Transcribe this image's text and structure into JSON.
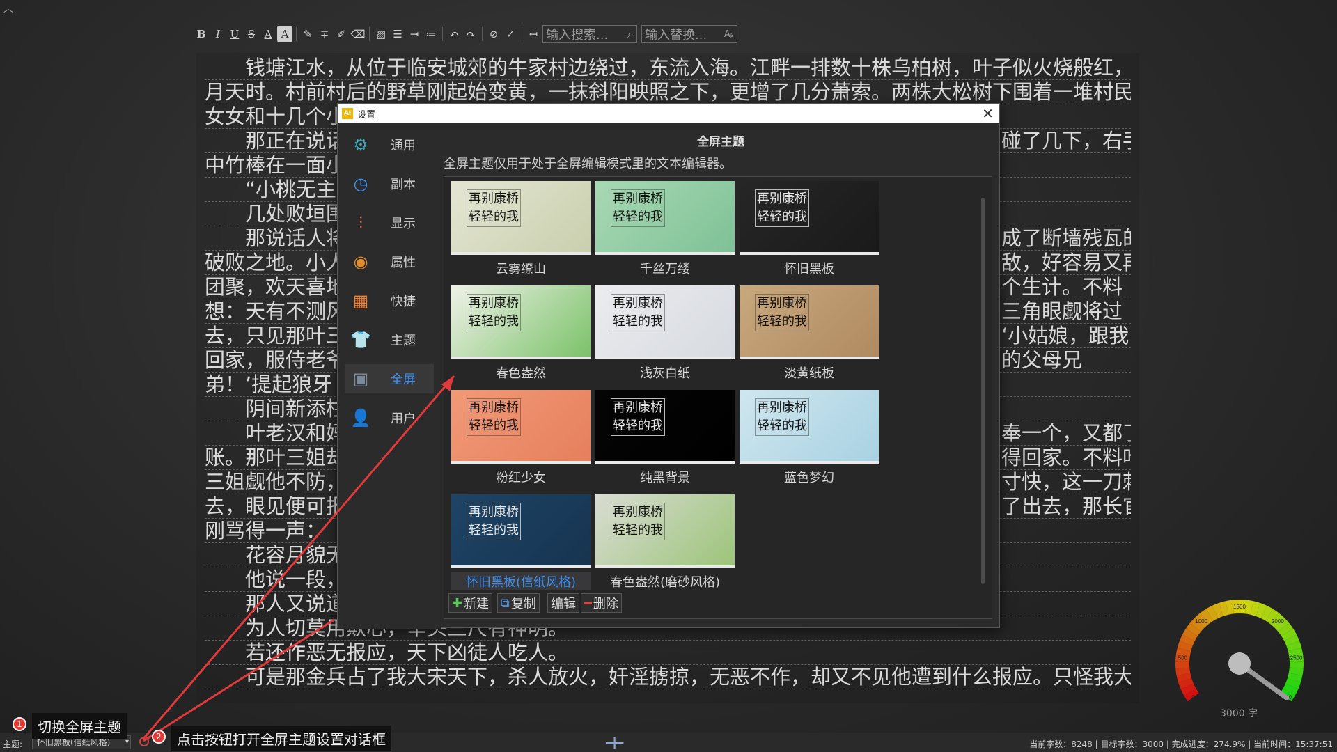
{
  "toolbar": {
    "icons": [
      "bold-icon",
      "italic-icon",
      "underline-icon",
      "strikethrough-icon",
      "font-color-icon",
      "highlight-icon",
      "pen-icon",
      "clear-format-icon",
      "pencil-icon",
      "eraser-icon",
      "image-icon",
      "align-icon",
      "indent-icon",
      "list-icon",
      "undo-icon",
      "redo-icon",
      "hide-icon",
      "spellcheck-icon",
      "return-icon"
    ],
    "search_placeholder": "输入搜索...",
    "replace_placeholder": "输入替换..."
  },
  "editor": {
    "lines": [
      {
        "text": "钱塘江水，从位于临安城郊的牛家村边绕过，东流入海。江畔一排数十株乌柏树，叶子似火烧般红，正是八",
        "indent": true
      },
      {
        "text": "月天时。村前村后的野草刚起始变黄，一抹斜阳映照之下，更增了几分萧索。两株大松树下围着一堆村民，男男",
        "indent": false
      },
      {
        "text": "女女和十几个小",
        "indent": false
      },
      {
        "text": "那正在说话",
        "indent": true,
        "right": "碰了几下，右手"
      },
      {
        "text": "中竹棒在一面小",
        "indent": false
      },
      {
        "text": "“小桃无主",
        "indent": true
      },
      {
        "text": "几处败垣围",
        "indent": true
      },
      {
        "text": "那说话人将",
        "indent": true,
        "right": "成了断墙残瓦的"
      },
      {
        "text": "破败之地。小人",
        "indent": false,
        "right": "敌，好容易又再"
      },
      {
        "text": "团聚，欢天喜地",
        "indent": false,
        "right": "个生计。不料"
      },
      {
        "text": "想：天有不测风",
        "indent": false,
        "right": "三角眼觑将过"
      },
      {
        "text": "去，只见那叶三",
        "indent": false,
        "right": "‘小姑娘，跟我"
      },
      {
        "text": "回家，服侍老爷",
        "indent": false,
        "right": "的父母兄"
      },
      {
        "text": "弟！’提起狼牙",
        "indent": false
      },
      {
        "text": "阴间新添柱",
        "indent": true
      },
      {
        "text": "叶老汉和妈",
        "indent": true,
        "right": "奉一个，又都了"
      },
      {
        "text": "账。那叶三姐却",
        "indent": false,
        "right": "得回家。不料叶"
      },
      {
        "text": "三姐觑他不防，",
        "indent": false,
        "right": "寸快，这一刀刺"
      },
      {
        "text": "去，眼见便可报",
        "indent": false,
        "right": "了出去，那长官"
      },
      {
        "text": "刚骂得一声：",
        "indent": false
      },
      {
        "text": "花容月貌无",
        "indent": true
      },
      {
        "text": "他说一段，",
        "indent": true
      },
      {
        "text": "那人又说道",
        "indent": true
      },
      {
        "text": "为人切莫用欺心，举头三尺有神明。",
        "indent": true
      },
      {
        "text": "若还作恶无报应，天下凶徒人吃人。",
        "indent": true
      },
      {
        "text": "可是那金兵占了我大宋天下，杀人放火，奸淫掳掠，无恶不作，却又不见他遭到什么报应。只怪我大宋官家",
        "indent": true
      }
    ]
  },
  "dialog": {
    "title": "设置",
    "app_icon_text": "AI",
    "close_label": "✕",
    "nav": [
      {
        "label": "通用",
        "icon": "gear-icon",
        "glyph": "⚙",
        "color": "#3fa7b5"
      },
      {
        "label": "副本",
        "icon": "clock-icon",
        "glyph": "◷",
        "color": "#3d8ef0"
      },
      {
        "label": "显示",
        "icon": "sliders-icon",
        "glyph": "⫶",
        "color": "#e05555"
      },
      {
        "label": "属性",
        "icon": "color-wheel-icon",
        "glyph": "◉",
        "color": "#e08a2a"
      },
      {
        "label": "快捷",
        "icon": "keyboard-icon",
        "glyph": "▦",
        "color": "#f08030"
      },
      {
        "label": "主题",
        "icon": "shirt-icon",
        "glyph": "👕",
        "color": "#2aa6d8"
      },
      {
        "label": "全屏",
        "icon": "fullscreen-icon",
        "glyph": "▣",
        "color": "#7a8a9a"
      },
      {
        "label": "用户",
        "icon": "user-settings-icon",
        "glyph": "👤",
        "color": "#3d8ef0"
      }
    ],
    "selected_nav": 6,
    "panel_title": "全屏主题",
    "panel_desc": "全屏主题仅用于处于全屏编辑模式里的文本编辑器。",
    "sample_line1": "再别康桥",
    "sample_line2": "轻轻的我",
    "themes": [
      {
        "name": "云雾缭山",
        "bg": "#e4e6d2",
        "bg2": "#c9cfae"
      },
      {
        "name": "千丝万缕",
        "bg": "#a8d9b4",
        "bg2": "#7fc196"
      },
      {
        "name": "怀旧黑板",
        "bg": "#262626",
        "bg2": "#1a1a1a"
      },
      {
        "name": "春色盎然",
        "bg": "#eef1e6",
        "bg2": "#7bc26a"
      },
      {
        "name": "浅灰白纸",
        "bg": "#eaecef",
        "bg2": "#d7dadf"
      },
      {
        "name": "淡黄纸板",
        "bg": "#c9a87e",
        "bg2": "#b08a60"
      },
      {
        "name": "粉红少女",
        "bg": "#f19a78",
        "bg2": "#e67f5c"
      },
      {
        "name": "纯黑背景",
        "bg": "#050505",
        "bg2": "#000000"
      },
      {
        "name": "蓝色梦幻",
        "bg": "#cfe6ef",
        "bg2": "#a9d2e2"
      },
      {
        "name": "怀旧黑板(信纸风格)",
        "bg": "#1e4466",
        "bg2": "#163450"
      },
      {
        "name": "春色盎然(磨砂风格)",
        "bg": "#d9dcd2",
        "bg2": "#9cc47a"
      }
    ],
    "selected_theme": 9,
    "actions": [
      {
        "label": "新建",
        "icon": "plus-icon",
        "glyph": "✚",
        "color": "#5cc85c"
      },
      {
        "label": "复制",
        "icon": "copy-icon",
        "glyph": "⧉",
        "color": "#4a8fe0"
      },
      {
        "label": "编辑",
        "icon": "",
        "glyph": "",
        "color": "#dcdcdc"
      },
      {
        "label": "删除",
        "icon": "minus-icon",
        "glyph": "━",
        "color": "#e04040"
      }
    ]
  },
  "statusbar": {
    "theme_label": "主题:",
    "theme_value": "怀旧黑板(信纸风格)",
    "info": "当前字数：8248  |  目标字数：3000  |  完成进度：274.9%  |  当前时间：15:37:51"
  },
  "callouts": {
    "one": {
      "num": "1",
      "text": "切换全屏主题"
    },
    "two": {
      "num": "2",
      "text": "点击按钮打开全屏主题设置对话框"
    }
  },
  "gauge": {
    "ticks": [
      "0",
      "500",
      "1000",
      "1500",
      "2000",
      "2500",
      "3000"
    ],
    "value": 3000,
    "max": 3000,
    "label": "3000 字"
  }
}
